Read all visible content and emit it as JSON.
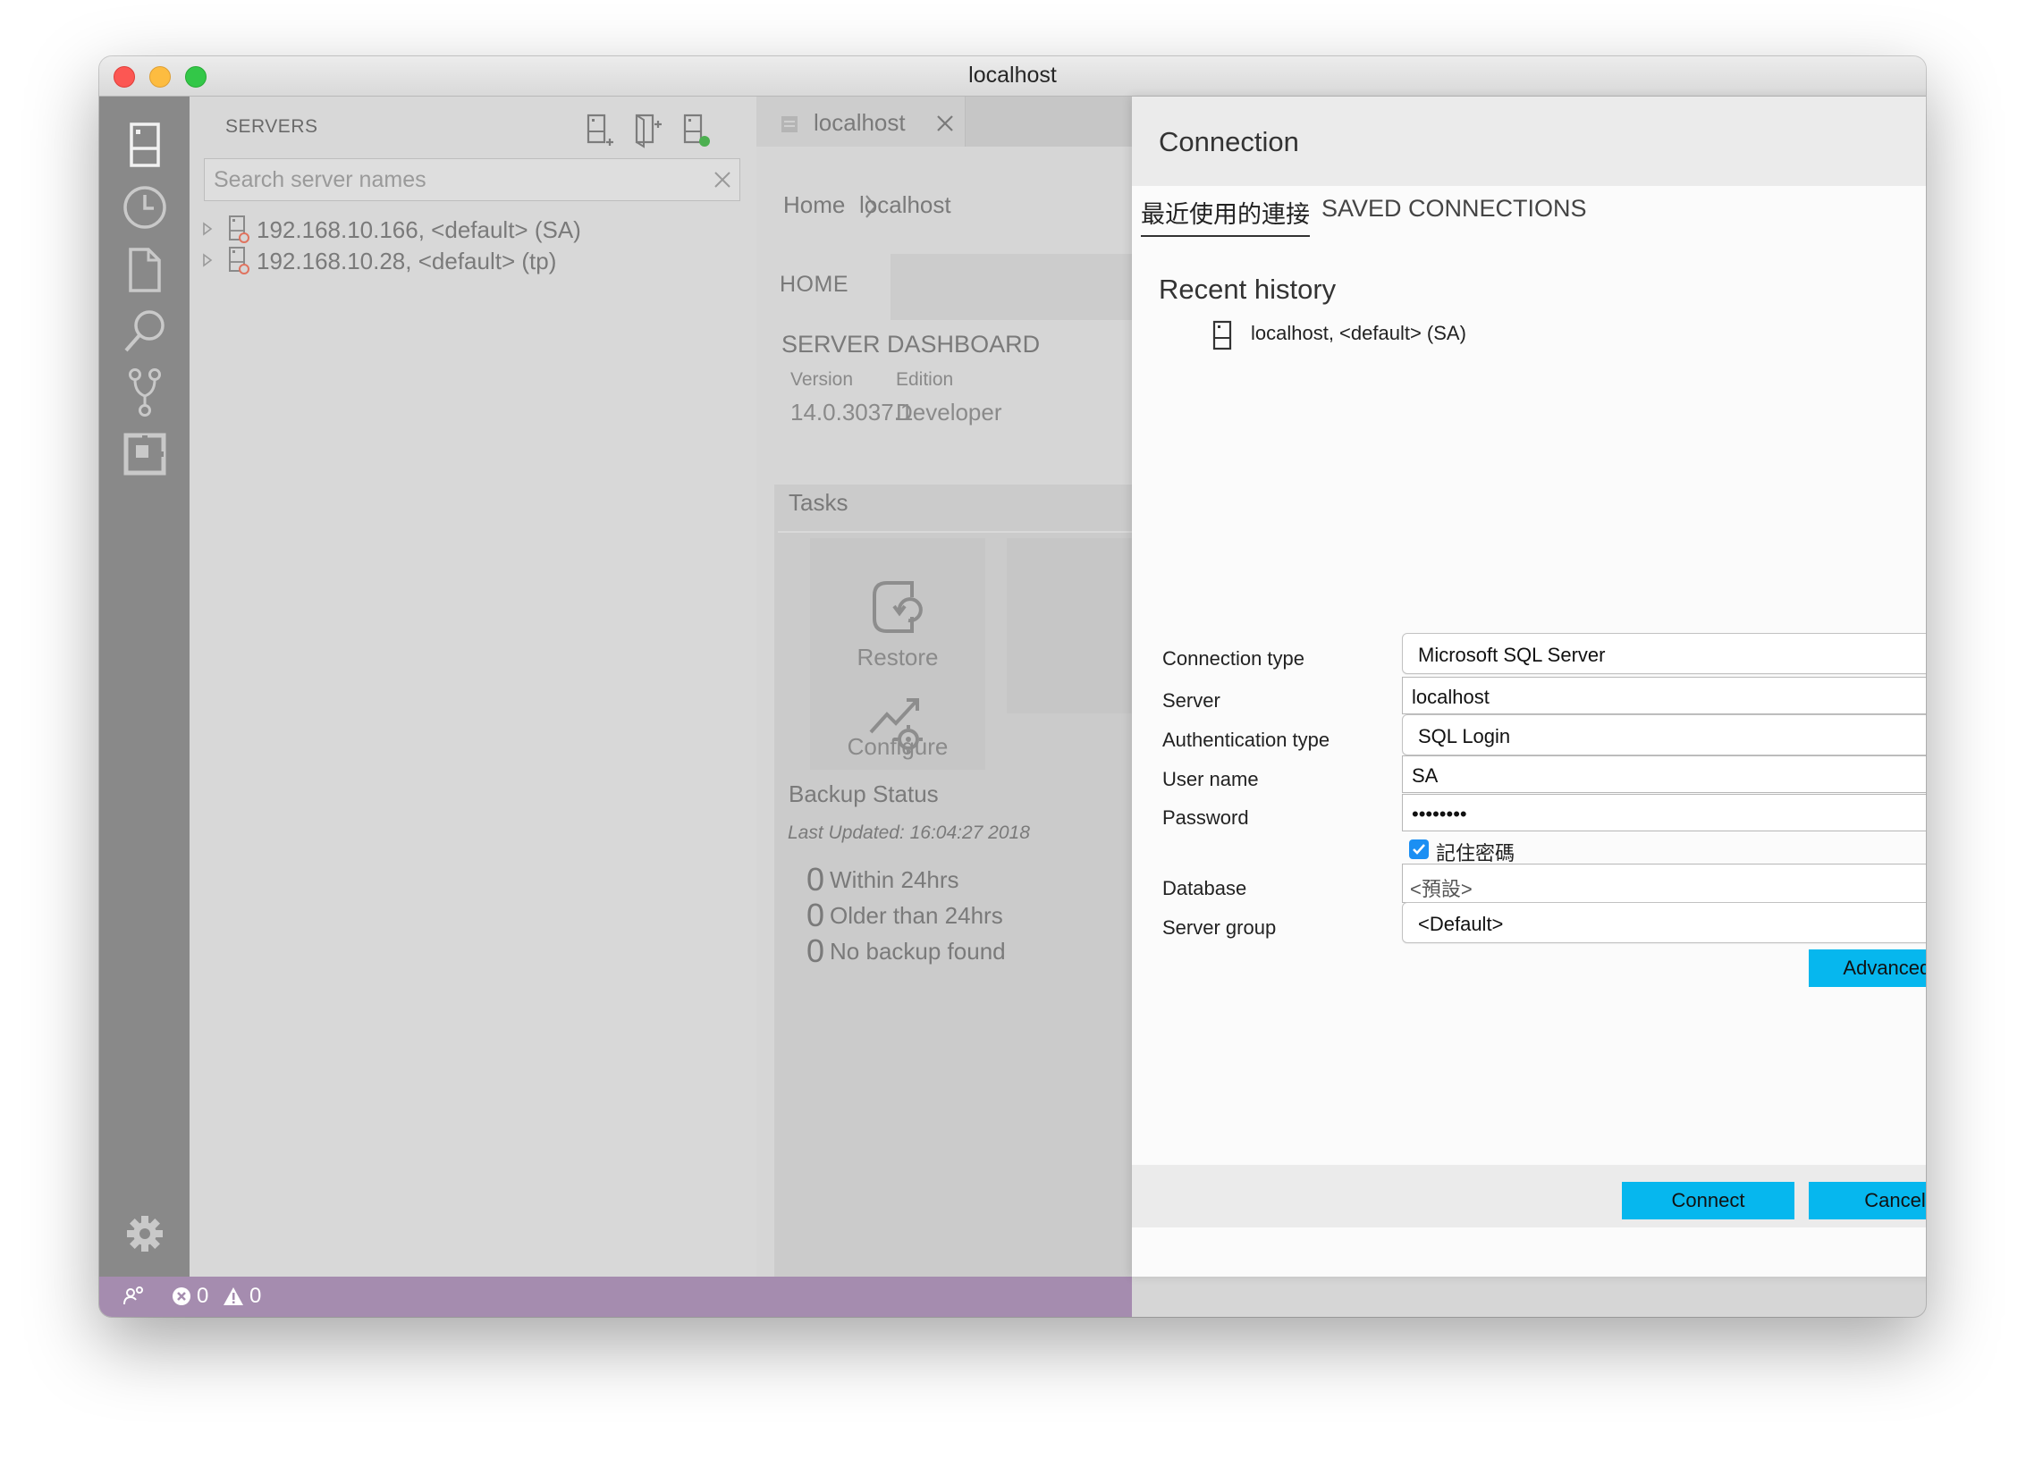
{
  "window": {
    "title": "localhost"
  },
  "activity_bar": {
    "items": [
      "servers-icon",
      "history-icon",
      "file-icon",
      "search-icon",
      "source-control-icon",
      "extensions-icon"
    ],
    "settings_icon": "gear-icon"
  },
  "sidebar": {
    "title": "SERVERS",
    "header_icons": [
      "new-connection-icon",
      "new-server-group-icon",
      "active-connections-icon"
    ],
    "search": {
      "placeholder": "Search server names",
      "value": ""
    },
    "servers": [
      {
        "label": "192.168.10.166, <default> (SA)"
      },
      {
        "label": "192.168.10.28, <default> (tp)"
      }
    ]
  },
  "editor": {
    "tab_label": "localhost",
    "breadcrumb": {
      "home": "Home",
      "current": "localhost"
    },
    "home_tab": "HOME",
    "dashboard_title": "SERVER DASHBOARD",
    "version_label": "Version",
    "version_value": "14.0.3037.1",
    "edition_label": "Edition",
    "edition_value": "Developer",
    "tasks_title": "Tasks",
    "tasks": [
      {
        "label": "Restore"
      },
      {
        "label": "Configure"
      }
    ],
    "backup": {
      "title": "Backup Status",
      "last_updated": "Last Updated: 16:04:27 2018",
      "rows": [
        {
          "count": "0",
          "text": "Within 24hrs"
        },
        {
          "count": "0",
          "text": "Older than 24hrs"
        },
        {
          "count": "0",
          "text": "No backup found"
        }
      ]
    }
  },
  "status_bar": {
    "errors": "0",
    "warnings": "0",
    "color": "#a58caf"
  },
  "dialog": {
    "title": "Connection",
    "tabs": [
      {
        "label": "最近使用的連接",
        "active": true
      },
      {
        "label": "SAVED CONNECTIONS",
        "active": false
      }
    ],
    "recent_history": {
      "title": "Recent history",
      "items": [
        {
          "label": "localhost, <default> (SA)"
        }
      ]
    },
    "form": {
      "connection_type": {
        "label": "Connection type",
        "value": "Microsoft SQL Server"
      },
      "server": {
        "label": "Server",
        "value": "localhost"
      },
      "auth_type": {
        "label": "Authentication type",
        "value": "SQL Login"
      },
      "user_name": {
        "label": "User name",
        "value": "SA"
      },
      "password": {
        "label": "Password",
        "value": "••••••••"
      },
      "remember_password": {
        "label": "記住密碼",
        "checked": true
      },
      "database": {
        "label": "Database",
        "value": "<預設>"
      },
      "server_group": {
        "label": "Server group",
        "value": "<Default>"
      }
    },
    "advanced_button": "Advanced...",
    "connect_button": "Connect",
    "cancel_button": "Cancel",
    "accent_color": "#06b7ee"
  }
}
